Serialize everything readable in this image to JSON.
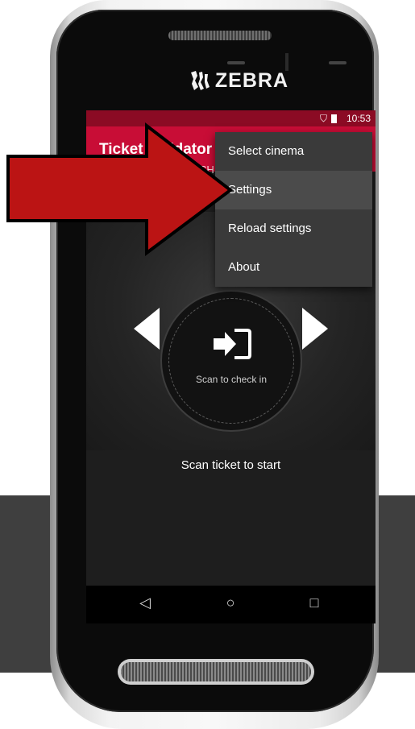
{
  "device": {
    "brand": "ZEBRA"
  },
  "status_bar": {
    "time": "10:53"
  },
  "app_bar": {
    "title": "Ticket Validator",
    "subtitle_fragment": "CH"
  },
  "menu": {
    "items": [
      {
        "label": "Select cinema"
      },
      {
        "label": "Settings"
      },
      {
        "label": "Reload settings"
      },
      {
        "label": "About"
      }
    ]
  },
  "scan": {
    "label": "Scan to check in"
  },
  "prompt": "Scan ticket to start",
  "nav": {
    "back": "◁",
    "home": "○",
    "recent": "□"
  },
  "colors": {
    "app_bar": "#c80d36",
    "status_bar": "#8b0b24",
    "callout": "#bb1414",
    "menu_bg": "#3a3a3a"
  }
}
